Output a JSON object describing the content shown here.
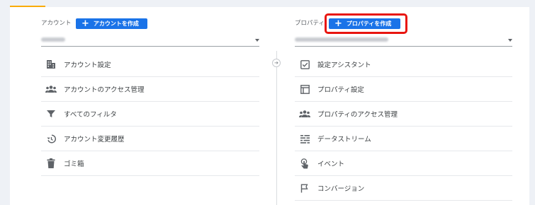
{
  "account": {
    "section_label": "アカウント",
    "create_button": "アカウントを作成",
    "menu": [
      {
        "label": "アカウント設定",
        "icon": "building-icon"
      },
      {
        "label": "アカウントのアクセス管理",
        "icon": "people-icon"
      },
      {
        "label": "すべてのフィルタ",
        "icon": "filter-icon"
      },
      {
        "label": "アカウント変更履歴",
        "icon": "history-icon"
      },
      {
        "label": "ゴミ箱",
        "icon": "trash-icon"
      }
    ]
  },
  "property": {
    "section_label": "プロパティ",
    "create_button": "プロパティを作成",
    "menu": [
      {
        "label": "設定アシスタント",
        "icon": "checkbox-icon"
      },
      {
        "label": "プロパティ設定",
        "icon": "property-settings-icon"
      },
      {
        "label": "プロパティのアクセス管理",
        "icon": "people-icon"
      },
      {
        "label": "データストリーム",
        "icon": "data-stream-icon"
      },
      {
        "label": "イベント",
        "icon": "touch-icon"
      },
      {
        "label": "コンバージョン",
        "icon": "flag-icon"
      }
    ]
  },
  "colors": {
    "accent_button": "#1a73e8",
    "highlight": "#e8150f",
    "tab_accent": "#f9ab00"
  }
}
